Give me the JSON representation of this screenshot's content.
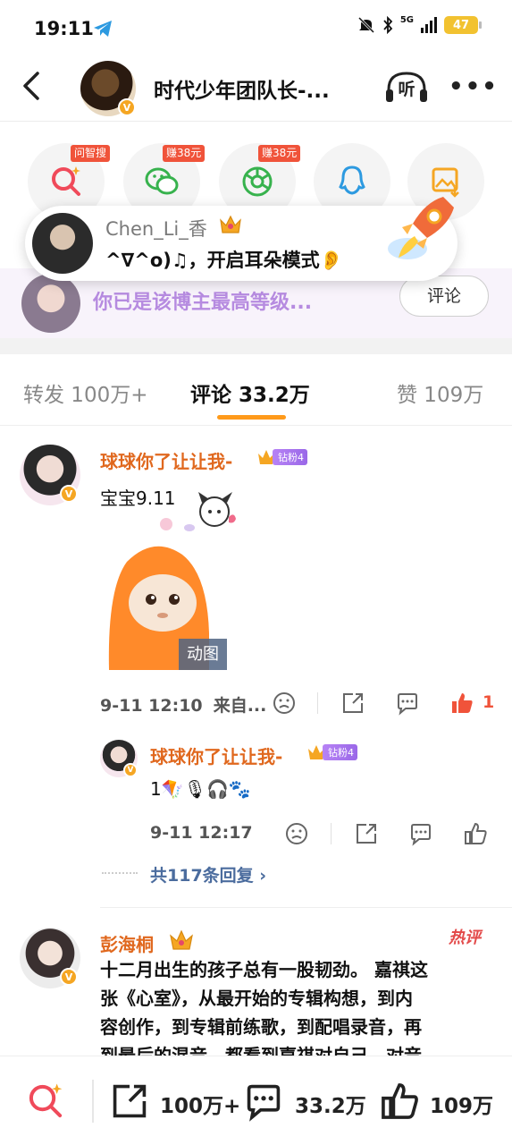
{
  "status_bar": {
    "time": "19:11",
    "network": "5G",
    "battery": "47"
  },
  "nav": {
    "title": "时代少年团队长-...",
    "listen_label": "听",
    "more_label": "•••"
  },
  "share_row": {
    "items": [
      {
        "icon": "search-icon",
        "tag": "问智搜"
      },
      {
        "icon": "wechat-icon",
        "tag": "赚38元"
      },
      {
        "icon": "moments-icon",
        "tag": "赚38元"
      },
      {
        "icon": "qq-icon",
        "tag": ""
      },
      {
        "icon": "save-image-icon",
        "tag": ""
      }
    ]
  },
  "toast": {
    "user": "Chen_Li_香",
    "message": "^∇^o)♫，开启耳朵模式👂"
  },
  "fan_row": {
    "text": "你已是该博主最高等级...",
    "button": "评论"
  },
  "tabs": [
    {
      "label": "转发 100万+",
      "active": false
    },
    {
      "label": "评论 33.2万",
      "active": true
    },
    {
      "label": "赞 109万",
      "active": false
    }
  ],
  "comments": [
    {
      "user": "球球你了让让我-",
      "badge": "钻粉4",
      "text": "宝宝9.11",
      "gif_label": "动图",
      "time": "9-11 12:10",
      "source": "来自...",
      "likes": "1",
      "reply": {
        "user": "球球你了让让我-",
        "badge": "钻粉4",
        "text": "1🪁🎙🎧🐾",
        "time": "9-11 12:17"
      },
      "replies_link": "共117条回复 ›"
    },
    {
      "user": "彭海桐",
      "hot_label": "热评",
      "text_lines": [
        "十二月出生的孩子总有一股韧劲。 嘉祺这",
        "张《心室》，从最开始的专辑构想，到内",
        "容创作，到专辑前练歌，到配唱录音，再",
        "到最后的混音，都看到嘉祺对自己，对音"
      ]
    }
  ],
  "bottom_bar": {
    "reposts": "100万+",
    "comments": "33.2万",
    "likes": "109万"
  },
  "colors": {
    "accent_orange": "#e0681e",
    "tab_underline": "#ff9a1a",
    "fan_purple": "#b68be0",
    "like_red": "#f0533a"
  }
}
